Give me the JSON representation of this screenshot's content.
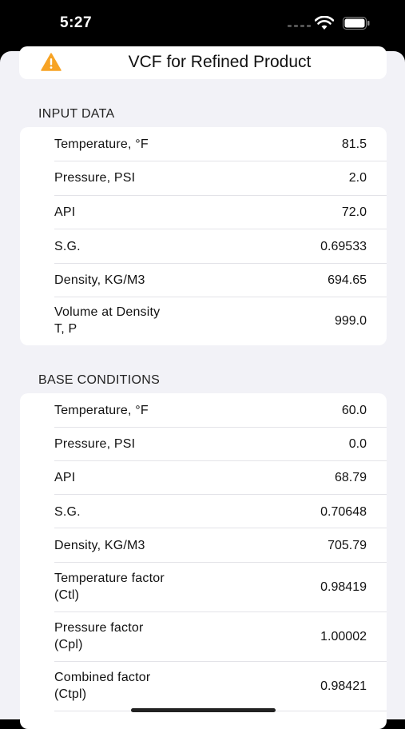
{
  "status": {
    "time": "5:27"
  },
  "header": {
    "title": "VCF for Refined Product"
  },
  "input": {
    "heading": "INPUT DATA",
    "rows": [
      {
        "label": "Temperature, °F",
        "value": "81.5"
      },
      {
        "label": "Pressure, PSI",
        "value": "2.0"
      },
      {
        "label": "API",
        "value": "72.0"
      },
      {
        "label": "S.G.",
        "value": "0.69533"
      },
      {
        "label": "Density, KG/M3",
        "value": "694.65"
      },
      {
        "label_l1": "Volume at Density",
        "label_l2": "T, P",
        "value": "999.0"
      }
    ]
  },
  "base": {
    "heading": "BASE CONDITIONS",
    "rows": [
      {
        "label": "Temperature, °F",
        "value": "60.0"
      },
      {
        "label": "Pressure, PSI",
        "value": "0.0"
      },
      {
        "label": "API",
        "value": "68.79"
      },
      {
        "label": "S.G.",
        "value": "0.70648"
      },
      {
        "label": "Density, KG/M3",
        "value": "705.79"
      },
      {
        "label_l1": "Temperature factor",
        "label_l2": "(Ctl)",
        "value": "0.98419"
      },
      {
        "label_l1": "Pressure factor",
        "label_l2": "(Cpl)",
        "value": "1.00002"
      },
      {
        "label_l1": "Combined factor",
        "label_l2": "(Ctpl)",
        "value": "0.98421"
      }
    ]
  },
  "colors": {
    "background": "#f2f2f7",
    "card": "#ffffff",
    "warning": "#f7a325"
  }
}
